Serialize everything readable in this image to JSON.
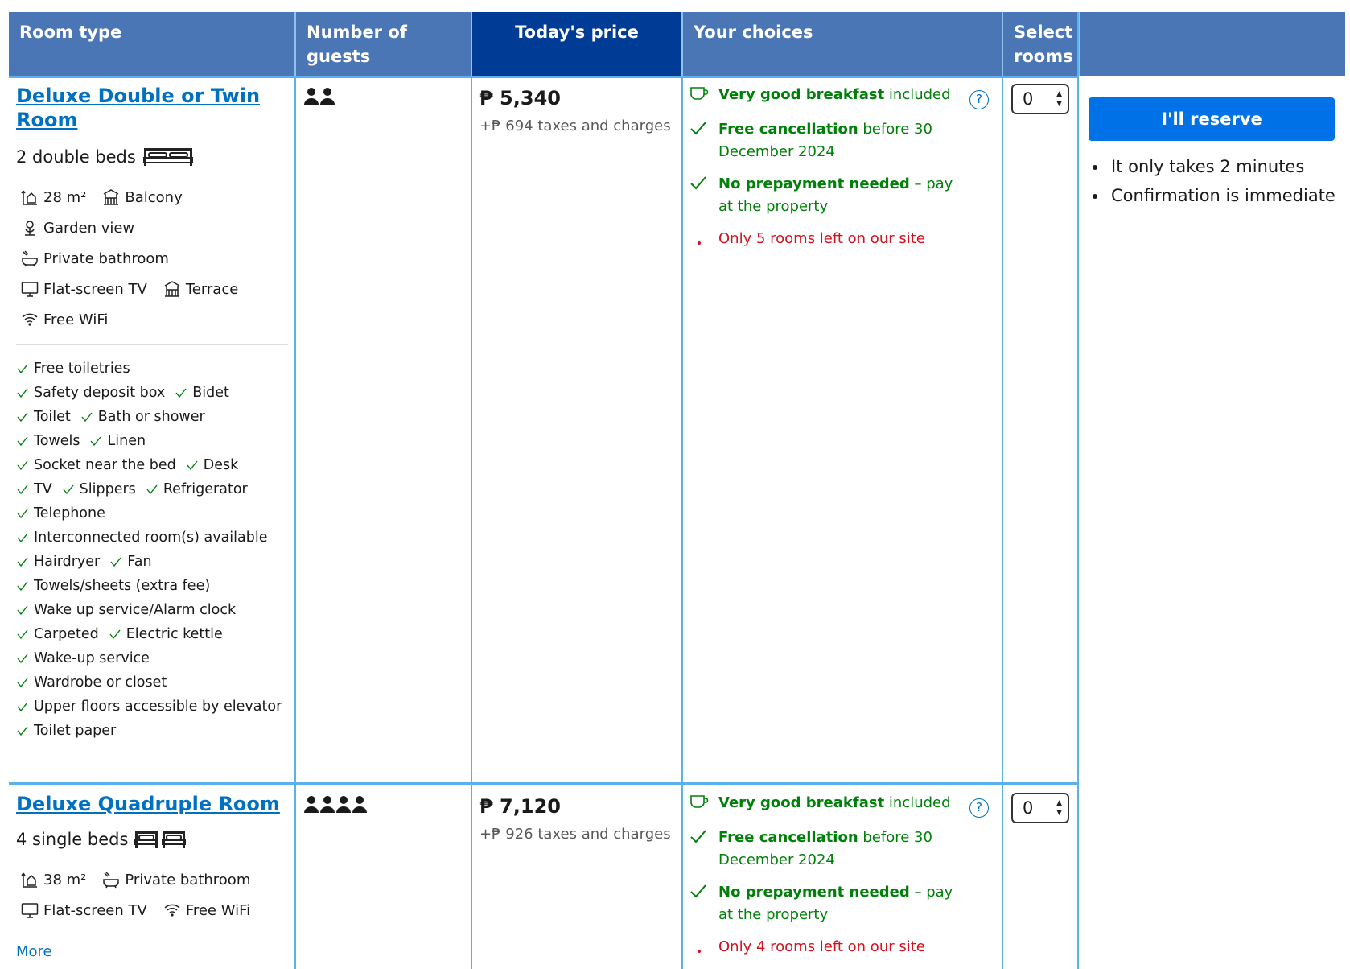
{
  "header": {
    "room_type": "Room type",
    "guests": "Number of guests",
    "price": "Today's price",
    "choices": "Your choices",
    "select_rooms": "Select rooms"
  },
  "rooms": [
    {
      "name_line1": "Deluxe Double or Twin",
      "name_line2": "Room",
      "beds": "2 double beds",
      "size": "28 m²",
      "balcony": "Balcony",
      "garden": "Garden view",
      "bathroom": "Private bathroom",
      "tv": "Flat-screen TV",
      "terrace": "Terrace",
      "wifi": "Free WiFi",
      "amenities": [
        "Free toiletries",
        "Safety deposit box",
        "Bidet",
        "Toilet",
        "Bath or shower",
        "Towels",
        "Linen",
        "Socket near the bed",
        "Desk",
        "TV",
        "Slippers",
        "Refrigerator",
        "Telephone",
        "Interconnected room(s) available",
        "Hairdryer",
        "Fan",
        "Towels/sheets (extra fee)",
        "Wake up service/Alarm clock",
        "Carpeted",
        "Electric kettle",
        "Wake-up service",
        "Wardrobe or closet",
        "Upper floors accessible by elevator",
        "Toilet paper"
      ],
      "price": "₱ 5,340",
      "tax": "+₱ 694 taxes and charges",
      "breakfast_bold": "Very good breakfast",
      "breakfast_rest": " included",
      "cancel_bold": "Free cancellation",
      "cancel_rest": " before 30 December 2024",
      "prepay_bold": "No prepayment needed",
      "prepay_rest": " – pay at the property",
      "left": "Only 5 rooms left on our site",
      "select_value": "0"
    },
    {
      "name_line1": "Deluxe Quadruple Room",
      "beds": "4 single beds",
      "size": "38 m²",
      "bathroom": "Private bathroom",
      "tv": "Flat-screen TV",
      "wifi": "Free WiFi",
      "more": "More",
      "price": "₱ 7,120",
      "tax": "+₱ 926 taxes and charges",
      "breakfast_bold": "Very good breakfast",
      "breakfast_rest": " included",
      "cancel_bold": "Free cancellation",
      "cancel_rest": " before 30 December 2024",
      "prepay_bold": "No prepayment needed",
      "prepay_rest": " – pay at the property",
      "left": "Only 4 rooms left on our site",
      "select_value": "0"
    }
  ],
  "reserve": {
    "button": "I'll reserve",
    "bullet1": "It only takes 2 minutes",
    "bullet2": "Confirmation is immediate"
  },
  "icons": {
    "help": "?"
  }
}
